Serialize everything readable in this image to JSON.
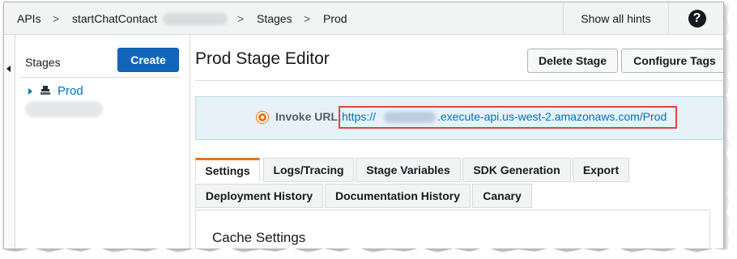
{
  "breadcrumb": {
    "apis": "APIs",
    "sep": ">",
    "api_name": "startChatContact",
    "stages": "Stages",
    "current": "Prod"
  },
  "header": {
    "show_hints": "Show all hints",
    "help_glyph": "?"
  },
  "sidebar": {
    "heading": "Stages",
    "create_label": "Create",
    "stage_items": [
      {
        "label": "Prod"
      }
    ]
  },
  "main": {
    "title": "Prod Stage Editor",
    "delete_label": "Delete Stage",
    "configure_tags_label": "Configure Tags",
    "invoke_label": "Invoke URL:",
    "invoke_url_prefix": "https://",
    "invoke_url_suffix": ".execute-api.us-west-2.amazonaws.com/Prod",
    "tabs_row1": [
      "Settings",
      "Logs/Tracing",
      "Stage Variables",
      "SDK Generation",
      "Export"
    ],
    "tabs_row2": [
      "Deployment History",
      "Documentation History",
      "Canary"
    ],
    "active_tab": "Settings",
    "section_title": "Cache Settings"
  },
  "icons": {
    "help": "question-circle-icon",
    "collapse": "caret-left-icon",
    "tree": "caret-right-icon",
    "stage": "stage-icon",
    "invoke": "radio-indicator-icon"
  },
  "colors": {
    "primary_button": "#1166bb",
    "link": "#0073bb",
    "active_tab_accent": "#ec7211",
    "invoke_box_bg": "#e6f2f8",
    "highlight": "#e0463e"
  }
}
